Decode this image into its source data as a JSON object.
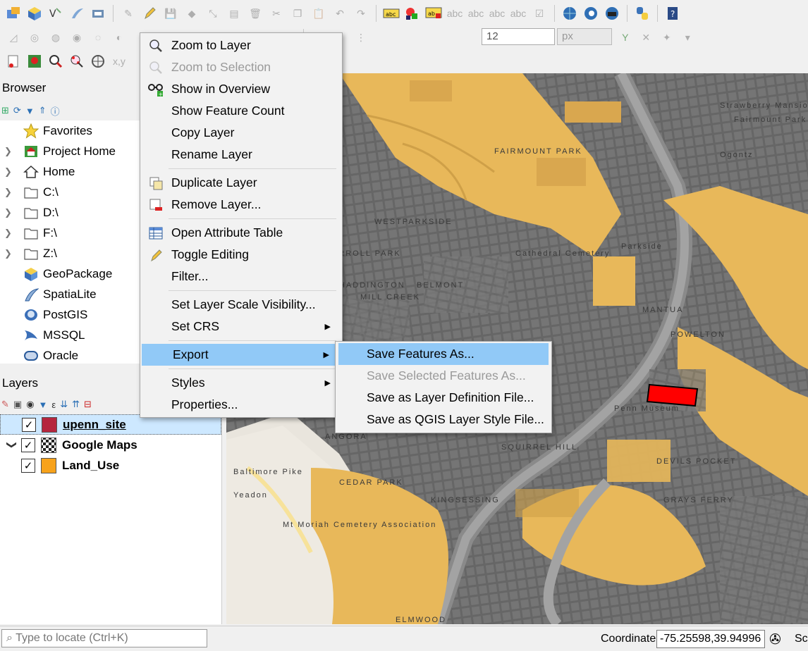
{
  "browser_panel": {
    "title": "Browser",
    "items": [
      {
        "label": "Favorites",
        "icon": "star-icon",
        "expandable": false
      },
      {
        "label": "Project Home",
        "icon": "project-home-icon",
        "expandable": true
      },
      {
        "label": "Home",
        "icon": "home-icon",
        "expandable": true
      },
      {
        "label": "C:\\",
        "icon": "folder-icon",
        "expandable": true
      },
      {
        "label": "D:\\",
        "icon": "folder-icon",
        "expandable": true
      },
      {
        "label": "F:\\",
        "icon": "folder-icon",
        "expandable": true
      },
      {
        "label": "Z:\\",
        "icon": "folder-icon",
        "expandable": true
      },
      {
        "label": "GeoPackage",
        "icon": "geopackage-icon",
        "expandable": false
      },
      {
        "label": "SpatiaLite",
        "icon": "spatialite-icon",
        "expandable": false
      },
      {
        "label": "PostGIS",
        "icon": "postgis-icon",
        "expandable": false
      },
      {
        "label": "MSSQL",
        "icon": "mssql-icon",
        "expandable": false
      },
      {
        "label": "Oracle",
        "icon": "oracle-icon",
        "expandable": false
      }
    ]
  },
  "layers_panel": {
    "title": "Layers",
    "layers": [
      {
        "name": "upenn_site",
        "checked": true,
        "swatch": "#b5263e",
        "selected": true,
        "expandable": false
      },
      {
        "name": "Google Maps",
        "checked": true,
        "swatch": "raster",
        "selected": false,
        "expandable": true
      },
      {
        "name": "Land_Use",
        "checked": true,
        "swatch": "#f7a21b",
        "selected": false,
        "expandable": false
      }
    ]
  },
  "toolbar": {
    "symbol_size": "12",
    "symbol_unit": "px"
  },
  "context_menu": {
    "items": [
      {
        "label": "Zoom to Layer",
        "icon": "zoom-layer-icon",
        "disabled": false
      },
      {
        "label": "Zoom to Selection",
        "icon": "zoom-selection-icon",
        "disabled": true
      },
      {
        "label": "Show in Overview",
        "icon": "overview-icon",
        "disabled": false
      },
      {
        "label": "Show Feature Count",
        "icon": "",
        "disabled": false
      },
      {
        "label": "Copy Layer",
        "icon": "",
        "disabled": false
      },
      {
        "label": "Rename Layer",
        "icon": "",
        "disabled": false
      },
      {
        "label": "Duplicate Layer",
        "icon": "duplicate-icon",
        "disabled": false
      },
      {
        "label": "Remove Layer...",
        "icon": "remove-layer-icon",
        "disabled": false
      },
      {
        "label": "Open Attribute Table",
        "icon": "attribute-table-icon",
        "disabled": false
      },
      {
        "label": "Toggle Editing",
        "icon": "pencil-icon",
        "disabled": false
      },
      {
        "label": "Filter...",
        "icon": "",
        "disabled": false
      },
      {
        "label": "Set Layer Scale Visibility...",
        "icon": "",
        "disabled": false
      },
      {
        "label": "Set CRS",
        "icon": "",
        "disabled": false
      },
      {
        "label": "Export",
        "icon": "",
        "disabled": false
      },
      {
        "label": "Styles",
        "icon": "",
        "disabled": false
      },
      {
        "label": "Properties...",
        "icon": "",
        "disabled": false
      }
    ]
  },
  "export_submenu": {
    "items": [
      {
        "label": "Save Features As...",
        "disabled": false
      },
      {
        "label": "Save Selected Features As...",
        "disabled": true
      },
      {
        "label": "Save as Layer Definition File...",
        "disabled": false
      },
      {
        "label": "Save as QGIS Layer Style File...",
        "disabled": false
      }
    ]
  },
  "map": {
    "labels": [
      "FAIRMOUNT PARK",
      "WESTPARKSIDE",
      "MANTUA",
      "POWELTON",
      "CARROLL PARK",
      "HADDINGTON",
      "MILL CREEK",
      "BELMONT",
      "SQUIRREL HILL",
      "KINGSESSING",
      "ANGORA",
      "CEDAR PARK",
      "GRAYS FERRY",
      "DEVILS POCKET",
      "Mt Moriah Cemetery Association",
      "Strawberry Mansion",
      "Fairmount Park",
      "Cathedral Cemetery",
      "Penn Museum",
      "Baltimore Pike",
      "Parkside",
      "Ogontz",
      "Yeadon",
      "ELMWOOD"
    ]
  },
  "statusbar": {
    "locator_placeholder": "Type to locate (Ctrl+K)",
    "coordinate_label": "Coordinate",
    "coordinate_value": "-75.25598,39.94996",
    "scale_label": "Sc"
  }
}
